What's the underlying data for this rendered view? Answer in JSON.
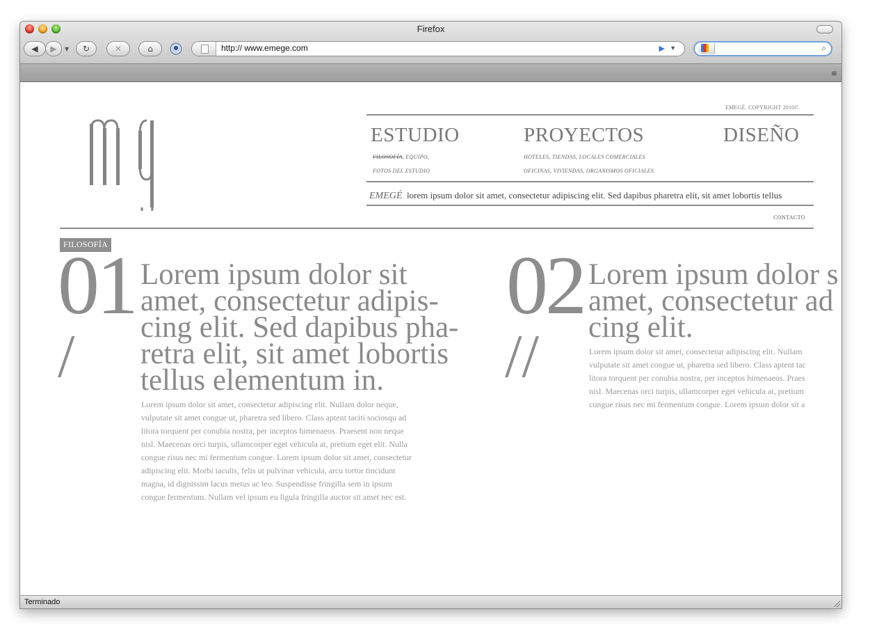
{
  "window": {
    "title": "Firefox"
  },
  "toolbar": {
    "back_icon": "back-arrow-icon",
    "forward_icon": "forward-arrow-icon",
    "url": "http:// www.emege.com",
    "search_placeholder": ""
  },
  "status": {
    "text": "Terminado"
  },
  "site": {
    "copyright": "EMEGÉ. COPYRIGHT 2010©",
    "nav": [
      {
        "label": "ESTUDIO",
        "sub1_struck": "FILOSOFÍA",
        "sub1_rest": ", EQUIPO,",
        "sub2": "FOTOS DEL ESTUDIO"
      },
      {
        "label": "PROYECTOS",
        "sub1": "HOTELES,  TIENDAS,  LOCALES COMERCIALES",
        "sub2": "OFICINAS,  VIVIENDAS,  ORGANISMOS OFICIALES"
      },
      {
        "label": "DISEÑO"
      }
    ],
    "tagline_brand": "EMEGÉ",
    "tagline_text": "lorem ipsum dolor sit amet, consectetur adipiscing elit. Sed dapibus pharetra elit, sit amet lobortis tellus",
    "contact": "CONTACTO",
    "section_tag": "FILOSOFÍA",
    "columns": [
      {
        "number": "01",
        "slashes": "/",
        "headline": "Lorem ipsum dolor sit\namet, consectetur adipis-\ncing elit. Sed dapibus pha-\nretra elit, sit amet lobortis\ntellus elementum in.",
        "body": "Lorem ipsum dolor sit amet, consectetur adipiscing elit. Nullam dolor neque,\nvulputate sit amet congue ut, pharetra sed libero. Class aptent taciti sociosqu ad\nlitora torquent per conubia nostra, per inceptos himenaeos. Praesent non neque\nnisl. Maecenas orci turpis, ullamcorper eget vehicula at, pretium eget elit. Nulla\ncongue risus nec mi fermentum congue. Lorem ipsum dolor sit amet, consectetur\nadipiscing elit. Morbi iaculis, felis ut pulvinar vehicula, arcu tortor tincidunt\nmagna, id dignissim lacus metus ac leo. Suspendisse fringilla sem in ipsum\ncongue fermentum. Nullam vel ipsum eu ligula fringilla auctor sit amet nec est."
      },
      {
        "number": "02",
        "slashes": "//",
        "headline": "Lorem ipsum dolor s\namet, consectetur ad\ncing elit.",
        "body": "Lorem ipsum dolor sit amet, consectetur adipiscing elit. Nullam\nvulputate sit amet congue ut, pharetra sed libero. Class aptent tac\nlitora torquent per conubia nostra, per inceptos himenaeos. Praes\nnisl. Maecenas orci turpis, ullamcorper eget vehicula at, pretium\ncongue risus nec mi fermentum congue. Lorem ipsum dolor sit a"
      }
    ]
  }
}
